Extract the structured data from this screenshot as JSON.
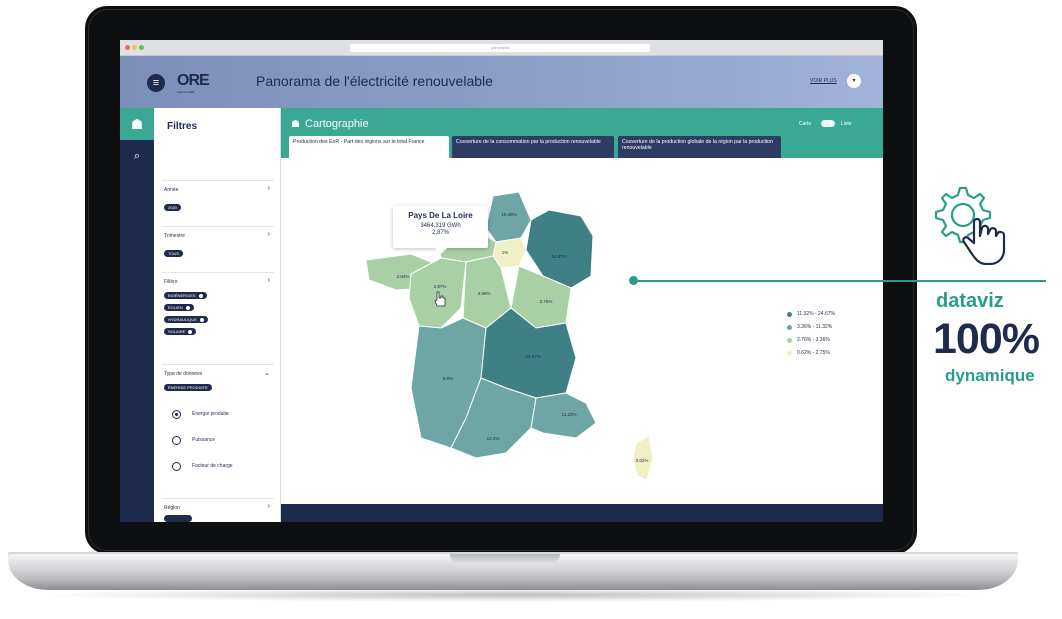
{
  "browser": {
    "url": "panorama"
  },
  "header": {
    "menu_icon": "hamburger-icon",
    "logo_text": "ORE",
    "logo_sub": "Agence ORE",
    "title": "Panorama de l'électricité renouvelable",
    "link": "VOIR PLUS",
    "avatar": "▾"
  },
  "rail": {
    "home_icon": "☗",
    "search_icon": "⌕"
  },
  "filters": {
    "title": "Filtres",
    "annee": {
      "label": "Année",
      "chip": "2020"
    },
    "trimestre": {
      "label": "Trimestre",
      "chip": "TOUS"
    },
    "filiere": {
      "label": "Filière",
      "chips": [
        "BIOÉNERGIES",
        "ÉOLIEN",
        "HYDRAULIQUE",
        "SOLAIRE"
      ]
    },
    "type": {
      "label": "Type de données",
      "chip": "ÉNERGIE PRODUITE",
      "options": [
        "Énergie produite",
        "Puissance",
        "Facteur de charge"
      ]
    },
    "region": {
      "label": "Région",
      "chip": ""
    }
  },
  "main": {
    "title": "Cartographie",
    "toggle_left": "Carte",
    "toggle_right": "Liste",
    "tabs": [
      "Production des EnR - Part des régions sur le total France",
      "Couverture de la consommation par la production renouvelable",
      "Couverture de la production globale de la région par la production renouvelable"
    ]
  },
  "map": {
    "tooltip": {
      "region": "Pays De La Loire",
      "value": "3464,319 GWh",
      "share": "2.87%"
    },
    "region_labels": [
      "10.48%",
      "1%",
      "14.87%",
      "2.84%",
      "2.87%",
      "3.96%",
      "2.76%",
      "9.0%",
      "24.67%",
      "14.2%",
      "11.22%",
      "0.62%"
    ],
    "legend": [
      {
        "label": "11.32% - 24.67%",
        "color": "#3f7f86"
      },
      {
        "label": "3.36% - 11.32%",
        "color": "#6ea6a5"
      },
      {
        "label": "2.76% - 3.36%",
        "color": "#a9cfa4"
      },
      {
        "label": "0.62% - 2.75%",
        "color": "#f1f0c4"
      }
    ]
  },
  "callout": {
    "line1": "dataviz",
    "line2": "100%",
    "line3": "dynamique",
    "icon": "gear-hand-icon"
  },
  "colors": {
    "teal": "#3aa893",
    "navy": "#1f2b4d",
    "accent": "#2a9d8a"
  }
}
